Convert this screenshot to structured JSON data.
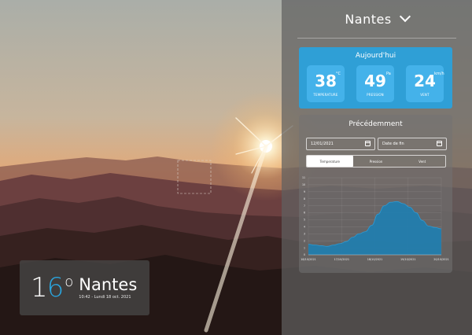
{
  "colors": {
    "accent": "#2aa6e0",
    "today_card": "#2f9fd6",
    "stat_tile": "#44b2ea",
    "chart_fill": "#1f7eb0"
  },
  "city_card": {
    "temp_digit_1": "1",
    "temp_digit_2": "6",
    "degree": "o",
    "city": "Nantes",
    "datetime": "10:42 - Lundi 18 oct. 2021"
  },
  "panel": {
    "title": "Nantes",
    "dropdown_icon": "chevron-down-icon"
  },
  "today": {
    "title": "Aujourd'hui",
    "stats": [
      {
        "value": "38",
        "unit": "°C",
        "label": "TEMPERATURE"
      },
      {
        "value": "49",
        "unit": "Pa",
        "label": "PRESSION"
      },
      {
        "value": "24",
        "unit": "km/h",
        "label": "VENT"
      }
    ]
  },
  "previous": {
    "title": "Précédemment",
    "start_date_value": "12/01/2021",
    "end_date_placeholder": "Date de fin",
    "tabs": [
      "Temperature",
      "Pression",
      "Vent"
    ],
    "active_tab": 0
  },
  "chart_data": {
    "type": "area",
    "x_ticks": [
      "18/10/2021",
      "17/10/2021",
      "18/10/2021",
      "19/10/2021",
      "20/10/2021"
    ],
    "y_ticks": [
      "0",
      "1",
      "2",
      "3",
      "4",
      "5",
      "6",
      "7",
      "8",
      "9",
      "10",
      "11"
    ],
    "ylim": [
      0,
      11
    ],
    "grid": true,
    "series": [
      {
        "values": [
          1.5,
          1.4,
          1.3,
          1.2,
          1.4,
          1.6,
          1.9,
          2.5,
          3.0,
          3.3,
          4.2,
          5.8,
          7.0,
          7.5,
          7.6,
          7.3,
          6.8,
          6.0,
          4.9,
          4.1,
          3.9,
          3.7
        ]
      }
    ]
  }
}
